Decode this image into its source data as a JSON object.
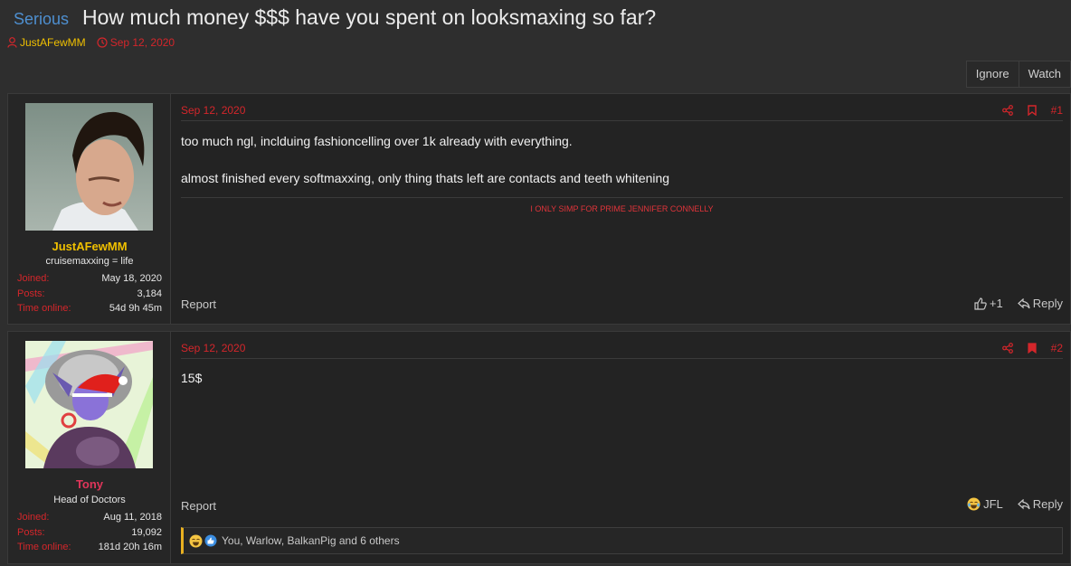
{
  "thread": {
    "prefix": "Serious",
    "title": "How much money $$$ have you spent on looksmaxing so far?",
    "author": "JustAFewMM",
    "date": "Sep 12, 2020",
    "actions": {
      "ignore": "Ignore",
      "watch": "Watch"
    }
  },
  "posts": [
    {
      "user": {
        "name": "JustAFewMM",
        "name_color": "#f0c000",
        "title": "cruisemaxxing = life",
        "stats": [
          {
            "label": "Joined:",
            "value": "May 18, 2020"
          },
          {
            "label": "Posts:",
            "value": "3,184"
          },
          {
            "label": "Time online:",
            "value": "54d 9h 45m"
          }
        ]
      },
      "date": "Sep 12, 2020",
      "number": "#1",
      "body": [
        "too much ngl, inclduing fashioncelling over 1k already with everything.",
        "almost finished every softmaxxing, only thing thats left are contacts and teeth whitening"
      ],
      "signature": "I ONLY SIMP FOR PRIME JENNIFER CONNELLY",
      "report": "Report",
      "react": "+1",
      "reply": "Reply",
      "bookmarked": false
    },
    {
      "user": {
        "name": "Tony",
        "name_color": "#e0355a",
        "title": "Head of Doctors",
        "stats": [
          {
            "label": "Joined:",
            "value": "Aug 11, 2018"
          },
          {
            "label": "Posts:",
            "value": "19,092"
          },
          {
            "label": "Time online:",
            "value": "181d 20h 16m"
          }
        ]
      },
      "date": "Sep 12, 2020",
      "number": "#2",
      "body": [
        "15$"
      ],
      "report": "Report",
      "react": "JFL",
      "reply": "Reply",
      "bookmarked": true,
      "reactions": "You, Warlow, BalkanPig and 6 others"
    }
  ],
  "colors": {
    "accent_red": "#d4262b",
    "prefix_blue": "#4e8fd0",
    "background": "#2e2e2e",
    "post_background": "#232323"
  }
}
